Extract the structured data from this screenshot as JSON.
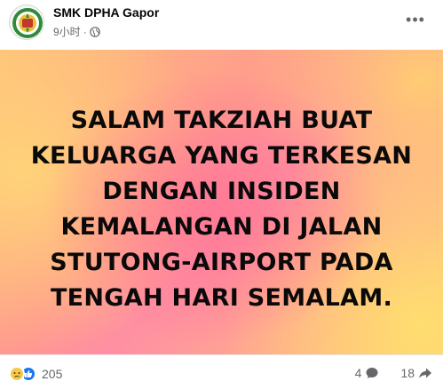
{
  "header": {
    "page_name": "SMK DPHA Gapor",
    "timestamp": "9小时",
    "privacy_icon": "globe-icon",
    "more_icon": "more-horizontal-icon",
    "more_glyph": "•••"
  },
  "image": {
    "lines": [
      "SALAM TAKZIAH BUAT",
      "KELUARGA YANG TERKESAN",
      "DENGAN INSIDEN",
      "KEMALANGAN DI JALAN",
      "STUTONG-AIRPORT PADA",
      "TENGAH HARI SEMALAM."
    ]
  },
  "footer": {
    "reaction_icons": [
      "sad-reaction-icon",
      "like-reaction-icon"
    ],
    "reaction_count": "205",
    "comment_count": "4",
    "comment_icon": "comment-icon",
    "share_count": "18",
    "share_icon": "share-icon"
  },
  "colors": {
    "like": "#1877f2",
    "sad": "#f7c84a",
    "secondary_text": "#65676b"
  }
}
